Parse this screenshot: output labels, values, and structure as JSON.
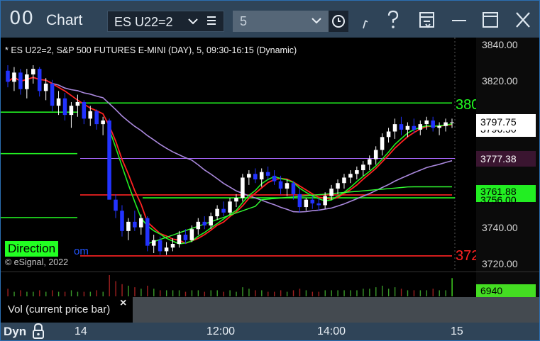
{
  "titlebar": {
    "app_icon_glyph": "00",
    "title": "Chart",
    "symbol": "ES U22=2",
    "interval": "5",
    "icons": [
      "chevron-down-icon",
      "list-icon",
      "clock-icon",
      "draw-icon",
      "help-icon",
      "template-icon",
      "minimize-icon",
      "maximize-icon",
      "close-icon"
    ]
  },
  "chart": {
    "header": "* ES U22=2, S&P 500 FUTURES E-MINI (DAY), 5, 09:30-16:15 (Dynamic)",
    "copyright": "© eSignal, 2022",
    "direction_label": "Direction",
    "direction_suffix": "om",
    "right_level_top": "380",
    "right_level_bottom": "372"
  },
  "chart_data": {
    "type": "candlestick",
    "y_range": [
      3716,
      3843
    ],
    "y_ticks": [
      "3840.00",
      "3820.00",
      "3740.00",
      "3720.00"
    ],
    "x_ticks": [
      "14",
      "12:00",
      "14:00",
      "15"
    ],
    "price_flags": {
      "last": "3797.75",
      "last_behind": "3796.50",
      "level_1": "3777.38",
      "level_2": "3761.88",
      "level_2_behind": "3756.00"
    },
    "horizontal_levels": [
      {
        "price": 3807.5,
        "color": "#22ff22"
      },
      {
        "price": 3777.4,
        "color": "#aa66ff"
      },
      {
        "price": 3757.6,
        "color": "#ff2222"
      },
      {
        "price": 3756.0,
        "color": "#22ff22"
      },
      {
        "price": 3724.5,
        "color": "#ff2222"
      }
    ],
    "candles": [
      [
        3825,
        3828,
        3816,
        3819
      ],
      [
        3819,
        3827,
        3814,
        3824
      ],
      [
        3824,
        3826,
        3812,
        3815
      ],
      [
        3815,
        3826,
        3810,
        3823
      ],
      [
        3823,
        3828,
        3818,
        3826
      ],
      [
        3826,
        3827,
        3811,
        3814
      ],
      [
        3814,
        3821,
        3809,
        3818
      ],
      [
        3818,
        3820,
        3803,
        3806
      ],
      [
        3806,
        3814,
        3801,
        3810
      ],
      [
        3810,
        3813,
        3798,
        3801
      ],
      [
        3801,
        3808,
        3794,
        3806
      ],
      [
        3806,
        3812,
        3800,
        3808
      ],
      [
        3808,
        3809,
        3796,
        3799
      ],
      [
        3799,
        3806,
        3795,
        3803
      ],
      [
        3803,
        3804,
        3793,
        3796
      ],
      [
        3796,
        3800,
        3790,
        3798
      ],
      [
        3798,
        3799,
        3762,
        3755
      ],
      [
        3755,
        3758,
        3745,
        3749
      ],
      [
        3749,
        3752,
        3735,
        3738
      ],
      [
        3738,
        3745,
        3733,
        3743
      ],
      [
        3743,
        3749,
        3738,
        3740
      ],
      [
        3740,
        3747,
        3736,
        3745
      ],
      [
        3745,
        3746,
        3727,
        3730
      ],
      [
        3730,
        3736,
        3726,
        3733
      ],
      [
        3733,
        3735,
        3725,
        3727
      ],
      [
        3727,
        3732,
        3725,
        3729
      ],
      [
        3729,
        3734,
        3727,
        3731
      ],
      [
        3731,
        3738,
        3729,
        3736
      ],
      [
        3736,
        3739,
        3731,
        3733
      ],
      [
        3733,
        3741,
        3732,
        3739
      ],
      [
        3739,
        3745,
        3736,
        3743
      ],
      [
        3743,
        3746,
        3739,
        3741
      ],
      [
        3741,
        3748,
        3739,
        3746
      ],
      [
        3746,
        3752,
        3744,
        3750
      ],
      [
        3750,
        3754,
        3746,
        3748
      ],
      [
        3748,
        3756,
        3747,
        3754
      ],
      [
        3754,
        3758,
        3751,
        3756
      ],
      [
        3756,
        3769,
        3754,
        3767
      ],
      [
        3767,
        3771,
        3763,
        3769
      ],
      [
        3769,
        3772,
        3764,
        3766
      ],
      [
        3766,
        3772,
        3762,
        3770
      ],
      [
        3770,
        3773,
        3766,
        3768
      ],
      [
        3768,
        3771,
        3763,
        3765
      ],
      [
        3765,
        3768,
        3758,
        3761
      ],
      [
        3761,
        3766,
        3757,
        3764
      ],
      [
        3764,
        3765,
        3755,
        3758
      ],
      [
        3758,
        3761,
        3748,
        3751
      ],
      [
        3751,
        3756,
        3749,
        3755
      ],
      [
        3755,
        3757,
        3750,
        3753
      ],
      [
        3753,
        3756,
        3749,
        3752
      ],
      [
        3752,
        3759,
        3750,
        3757
      ],
      [
        3757,
        3763,
        3755,
        3761
      ],
      [
        3761,
        3766,
        3758,
        3764
      ],
      [
        3764,
        3769,
        3761,
        3767
      ],
      [
        3767,
        3771,
        3764,
        3769
      ],
      [
        3769,
        3773,
        3766,
        3771
      ],
      [
        3771,
        3776,
        3768,
        3774
      ],
      [
        3774,
        3779,
        3771,
        3777
      ],
      [
        3777,
        3784,
        3774,
        3782
      ],
      [
        3782,
        3791,
        3779,
        3789
      ],
      [
        3789,
        3794,
        3786,
        3792
      ],
      [
        3792,
        3799,
        3788,
        3796
      ],
      [
        3796,
        3800,
        3790,
        3793
      ],
      [
        3793,
        3797,
        3789,
        3795
      ],
      [
        3795,
        3799,
        3791,
        3793
      ],
      [
        3793,
        3798,
        3790,
        3796
      ],
      [
        3796,
        3800,
        3793,
        3798
      ],
      [
        3798,
        3800,
        3792,
        3794
      ],
      [
        3794,
        3797,
        3790,
        3795
      ],
      [
        3795,
        3799,
        3792,
        3797
      ],
      [
        3797,
        3799,
        3794,
        3797
      ]
    ],
    "volume": [
      5,
      3,
      4,
      3,
      3,
      4,
      3,
      4,
      3,
      3,
      4,
      3,
      3,
      3,
      4,
      3,
      14,
      10,
      8,
      7,
      6,
      5,
      7,
      5,
      4,
      4,
      4,
      4,
      3,
      4,
      4,
      3,
      4,
      4,
      3,
      4,
      3,
      6,
      5,
      4,
      4,
      3,
      3,
      4,
      3,
      4,
      5,
      4,
      3,
      3,
      4,
      4,
      4,
      4,
      4,
      4,
      5,
      5,
      6,
      7,
      5,
      6,
      5,
      4,
      4,
      4,
      4,
      5,
      4,
      4,
      12
    ]
  },
  "volume_pane": {
    "value": "6940"
  },
  "study_strip": {
    "label": "Vol (current price bar)",
    "close_glyph": "×"
  },
  "time_axis": {
    "dyn_label": "Dyn"
  },
  "colors": {
    "up_candle": "#ffffff",
    "down_candle": "#2233ff",
    "ma_red": "#ff2222",
    "ma_green": "#22ee22",
    "ma_purple": "#aa88dd",
    "vwap_green": "#33ff33",
    "level_1_flag": "#3a1530",
    "level_2_flag": "#22ee22"
  }
}
